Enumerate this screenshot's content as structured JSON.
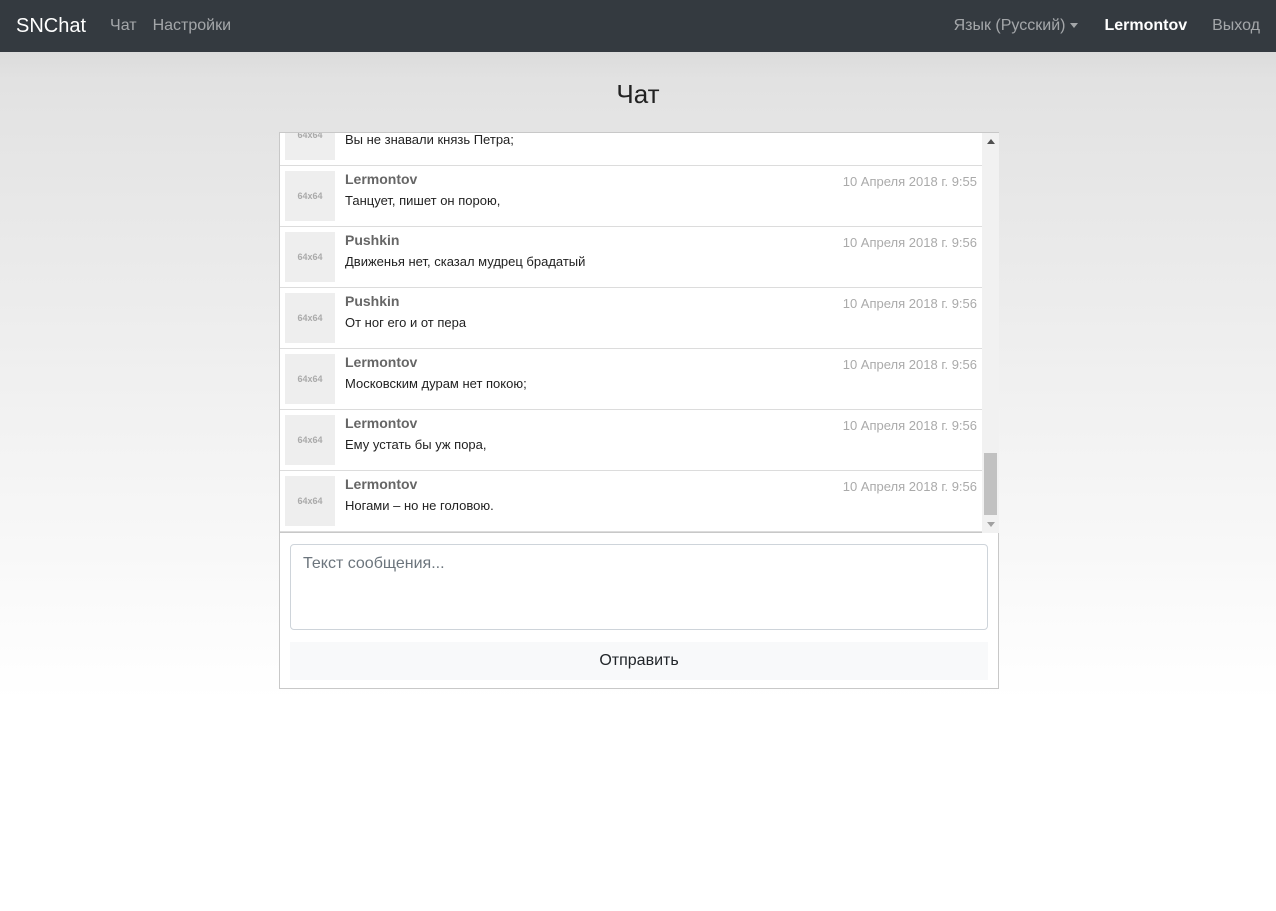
{
  "nav": {
    "brand": "SNChat",
    "links": [
      "Чат",
      "Настройки"
    ],
    "language": "Язык (Русский)",
    "user": "Lermontov",
    "logout": "Выход"
  },
  "page": {
    "title": "Чат"
  },
  "messages": [
    {
      "avatar": "64x64",
      "author": "",
      "time": "",
      "text": "Вы не знавали князь Петра;"
    },
    {
      "avatar": "64x64",
      "author": "Lermontov",
      "time": "10 Апреля 2018 г. 9:55",
      "text": "Танцует, пишет он порою,"
    },
    {
      "avatar": "64x64",
      "author": "Pushkin",
      "time": "10 Апреля 2018 г. 9:56",
      "text": "Движенья нет, сказал мудрец брадатый"
    },
    {
      "avatar": "64x64",
      "author": "Pushkin",
      "time": "10 Апреля 2018 г. 9:56",
      "text": "От ног его и от пера"
    },
    {
      "avatar": "64x64",
      "author": "Lermontov",
      "time": "10 Апреля 2018 г. 9:56",
      "text": "Московским дурам нет покою;"
    },
    {
      "avatar": "64x64",
      "author": "Lermontov",
      "time": "10 Апреля 2018 г. 9:56",
      "text": "Ему устать бы уж пора,"
    },
    {
      "avatar": "64x64",
      "author": "Lermontov",
      "time": "10 Апреля 2018 г. 9:56",
      "text": "Ногами – но не головою."
    }
  ],
  "composer": {
    "placeholder": "Текст сообщения...",
    "send_label": "Отправить"
  }
}
